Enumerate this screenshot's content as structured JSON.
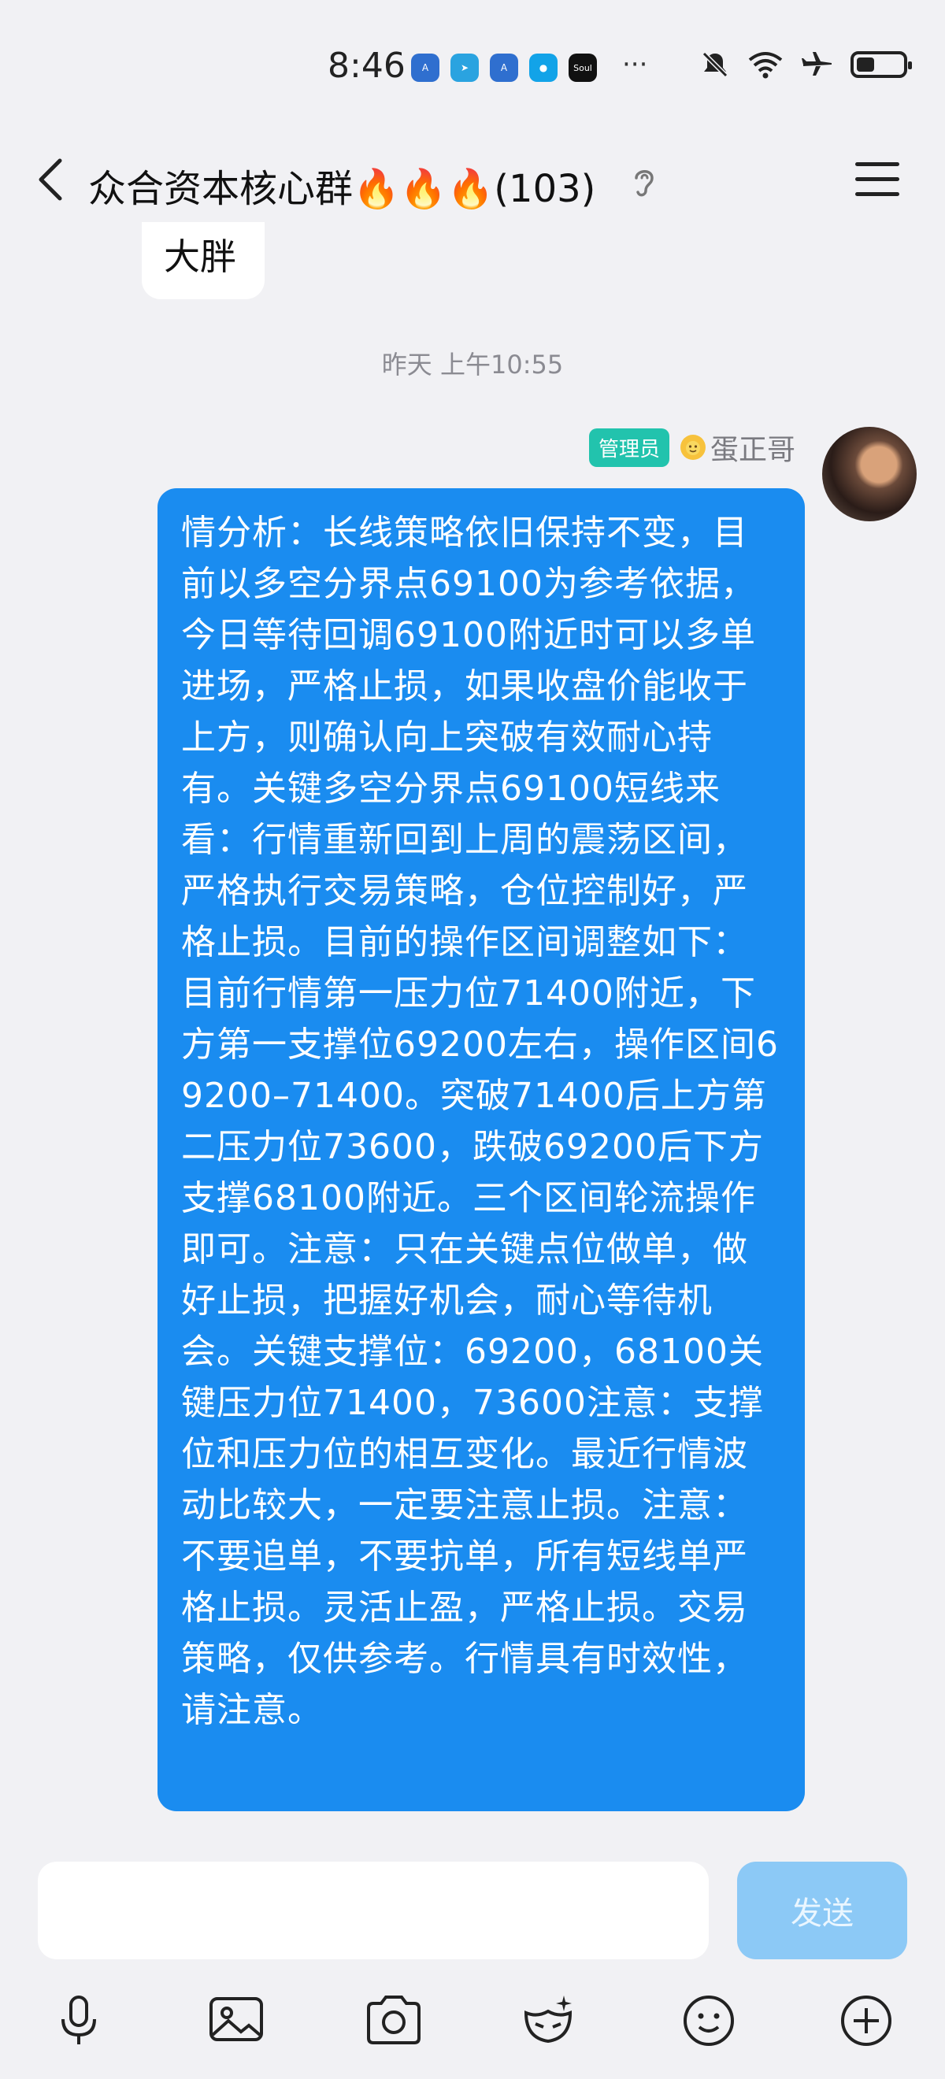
{
  "status_bar": {
    "time": "8:46",
    "apps": [
      {
        "name": "app-icon-a",
        "color": "#2f6fcf",
        "glyph": "A"
      },
      {
        "name": "telegram-icon",
        "color": "#2aa3e0",
        "glyph": "➤"
      },
      {
        "name": "app-icon-b",
        "color": "#2f6fcf",
        "glyph": "A"
      },
      {
        "name": "app-icon-c",
        "color": "#12a3e8",
        "glyph": "●"
      },
      {
        "name": "soul-icon",
        "color": "#111111",
        "glyph": "Soul"
      }
    ],
    "more": "···"
  },
  "header": {
    "title": "众合资本核心群🔥🔥🔥(103)"
  },
  "previous_message": {
    "text": "大胖"
  },
  "timestamp": "昨天 上午10:55",
  "message": {
    "badge": "管理员",
    "sender": "蛋正哥",
    "text": "情分析：长线策略依旧保持不变，目前以多空分界点69100为参考依据，今日等待回调69100附近时可以多单进场，严格止损，如果收盘价能收于上方，则确认向上突破有效耐心持有。关键多空分界点69100短线来看：行情重新回到上周的震荡区间，严格执行交易策略，仓位控制好，严格止损。目前的操作区间调整如下：目前行情第一压力位71400附近，下方第一支撑位69200左右，操作区间69200–71400。突破71400后上方第二压力位73600，跌破69200后下方支撑68100附近。三个区间轮流操作即可。注意：只在关键点位做单，做好止损，把握好机会，耐心等待机会。关键支撑位：69200，68100关键压力位71400，73600注意：支撑位和压力位的相互变化。最近行情波动比较大，一定要注意止损。注意：不要追单，不要抗单，所有短线单严格止损。灵活止盈，严格止损。交易策略，仅供参考。行情具有时效性，请注意。"
  },
  "input": {
    "placeholder": "",
    "send_label": "发送"
  },
  "colors": {
    "bubble": "#1a8cf0",
    "admin_badge": "#22c3ad",
    "send_disabled": "#8cc9f6"
  }
}
